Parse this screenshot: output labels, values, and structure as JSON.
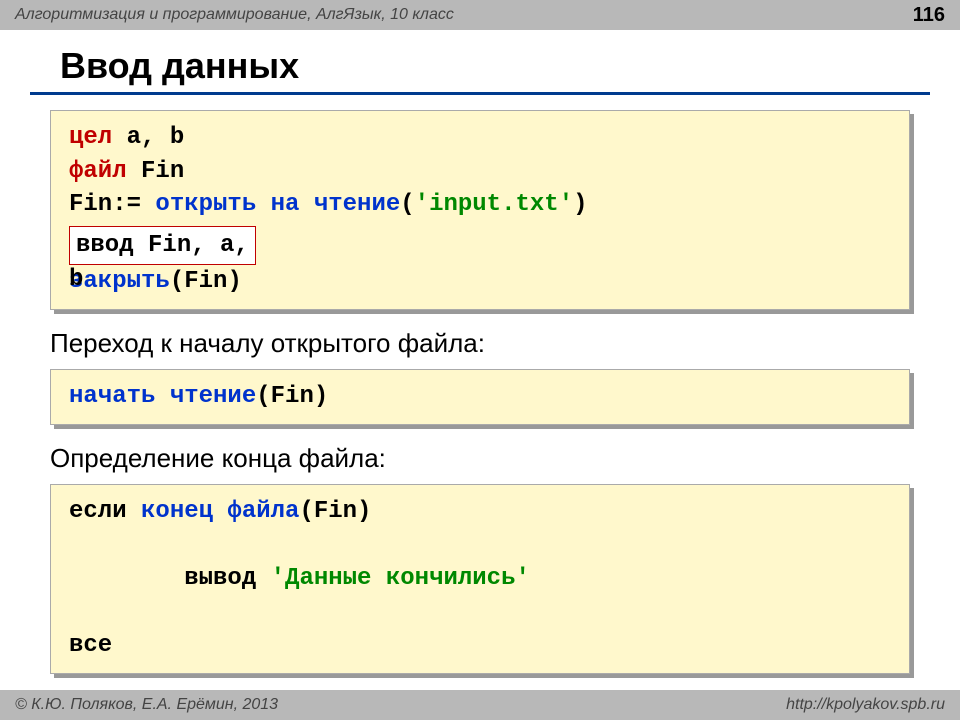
{
  "header": {
    "left": "Алгоритмизация и программирование, АлгЯзык, 10 класс",
    "page_num": "116"
  },
  "title": "Ввод данных",
  "block1": {
    "line1_kw": "цел",
    "line1_rest": " a, b",
    "line2_kw": "файл",
    "line2_rest": " Fin",
    "line3_a": "Fin:=",
    "line3_kw": " открыть на чтение",
    "line3_paren": "(",
    "line3_file": "'input.txt'",
    "line3_close": ")",
    "inset": " ввод Fin, a,",
    "overlay": "b",
    "line5_kw": "закрыть",
    "line5_rest": "(Fin)"
  },
  "sub1": "Переход к началу открытого файла:",
  "block2": {
    "kw": "начать чтение",
    "rest": "(Fin)"
  },
  "sub2": "Определение конца файла:",
  "block3": {
    "line1_a": "если",
    "line1_kw": " конец файла",
    "line1_rest": "(Fin)",
    "line2_a": "  вывод ",
    "line2_str": "'Данные кончились'",
    "line3": "все"
  },
  "footer": {
    "left": "© К.Ю. Поляков, Е.А. Ерёмин, 2013",
    "right": "http://kpolyakov.spb.ru"
  }
}
